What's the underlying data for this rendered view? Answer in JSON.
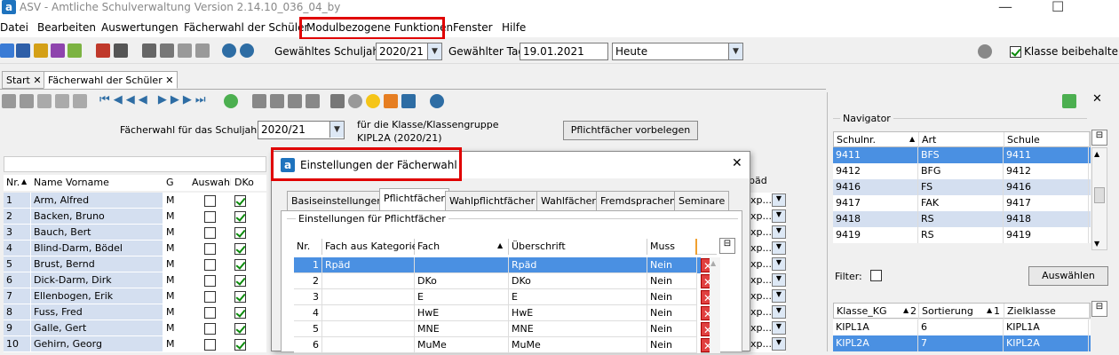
{
  "window": {
    "title": "ASV - Amtliche Schulverwaltung Version 2.14.10_036_04_by",
    "minimize": "—",
    "maximize": "☐"
  },
  "menu": [
    "Datei",
    "Bearbeiten",
    "Auswertungen",
    "Fächerwahl der Schüler",
    "Modulbezogene Funktionen",
    "Fenster",
    "Hilfe"
  ],
  "toolbar": {
    "schuljahr_label": "Gewähltes Schuljahr",
    "schuljahr_value": "2020/21",
    "tag_label": "Gewählter Tag",
    "tag_value": "19.01.2021",
    "heute_value": "Heute",
    "keep_class_label": "Klasse beibehalten"
  },
  "tabs": [
    {
      "label": "Start"
    },
    {
      "label": "Fächerwahl der Schüler"
    }
  ],
  "main": {
    "schuljahr_label": "Fächerwahl für das Schuljahr",
    "schuljahr_value": "2020/21",
    "class_label": "für die Klasse/Klassengruppe",
    "class_value": "KIPL2A (2020/21)",
    "pflicht_button": "Pflichtfächer vorbelegen",
    "columns": [
      "Nr.",
      "Name Vorname",
      "G",
      "Auswahl",
      "DKo"
    ],
    "right_col_header": "päd",
    "right_col_value": "xp...",
    "students": [
      {
        "nr": "1",
        "name": "Arm, Alfred",
        "g": "M"
      },
      {
        "nr": "2",
        "name": "Backen, Bruno",
        "g": "M"
      },
      {
        "nr": "3",
        "name": "Bauch, Bert",
        "g": "M"
      },
      {
        "nr": "4",
        "name": "Blind-Darm, Bödel",
        "g": "M"
      },
      {
        "nr": "5",
        "name": "Brust, Bernd",
        "g": "M"
      },
      {
        "nr": "6",
        "name": "Dick-Darm, Dirk",
        "g": "M"
      },
      {
        "nr": "7",
        "name": "Ellenbogen, Erik",
        "g": "M"
      },
      {
        "nr": "8",
        "name": "Fuss, Fred",
        "g": "M"
      },
      {
        "nr": "9",
        "name": "Galle, Gert",
        "g": "M"
      },
      {
        "nr": "10",
        "name": "Gehirn, Georg",
        "g": "M"
      }
    ]
  },
  "dialog": {
    "title": "Einstellungen der Fächerwahl",
    "close": "✕",
    "tabs": [
      "Basiseinstellungen",
      "Pflichtfächer",
      "Wahlpflichtfächer",
      "Wahlfächer",
      "Fremdsprachen",
      "Seminare"
    ],
    "group_label": "Einstellungen für Pflichtfächer",
    "columns": [
      "Nr.",
      "Fach aus Kategorie",
      "Fach",
      "Überschrift",
      "Muss"
    ],
    "rows": [
      {
        "nr": "1",
        "kat": "Rpäd",
        "fach": "",
        "ueb": "Rpäd",
        "muss": "Nein"
      },
      {
        "nr": "2",
        "kat": "",
        "fach": "DKo",
        "ueb": "DKo",
        "muss": "Nein"
      },
      {
        "nr": "3",
        "kat": "",
        "fach": "E",
        "ueb": "E",
        "muss": "Nein"
      },
      {
        "nr": "4",
        "kat": "",
        "fach": "HwE",
        "ueb": "HwE",
        "muss": "Nein"
      },
      {
        "nr": "5",
        "kat": "",
        "fach": "MNE",
        "ueb": "MNE",
        "muss": "Nein"
      },
      {
        "nr": "6",
        "kat": "",
        "fach": "MuMe",
        "ueb": "MuMe",
        "muss": "Nein"
      }
    ]
  },
  "navigator": {
    "title": "Navigator",
    "columns": [
      "Schulnr.",
      "Art",
      "Schule"
    ],
    "rows": [
      {
        "nr": "9411",
        "art": "BFS",
        "schule": "9411"
      },
      {
        "nr": "9412",
        "art": "BFG",
        "schule": "9412"
      },
      {
        "nr": "9416",
        "art": "FS",
        "schule": "9416"
      },
      {
        "nr": "9417",
        "art": "FAK",
        "schule": "9417"
      },
      {
        "nr": "9418",
        "art": "RS",
        "schule": "9418"
      },
      {
        "nr": "9419",
        "art": "RS",
        "schule": "9419"
      }
    ],
    "filter_label": "Filter:",
    "select_button": "Auswählen",
    "class_columns": [
      "Klasse_KG",
      "2",
      "Sortierung",
      "1",
      "Zielklasse"
    ],
    "class_rows": [
      {
        "kg": "KIPL1A",
        "sort": "6",
        "ziel": "KIPL1A"
      },
      {
        "kg": "KIPL2A",
        "sort": "7",
        "ziel": "KIPL2A"
      }
    ]
  }
}
